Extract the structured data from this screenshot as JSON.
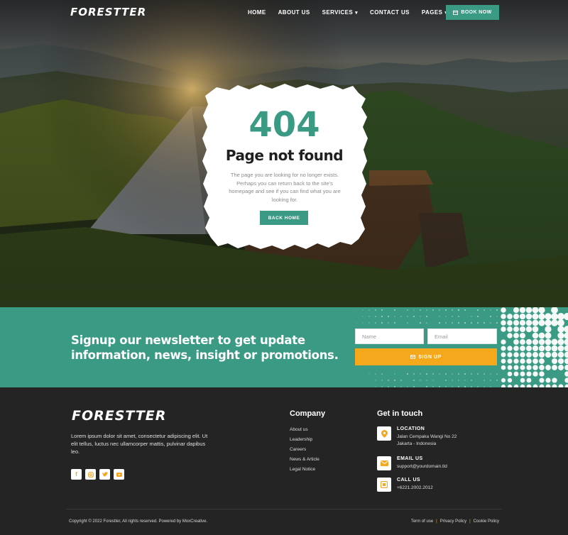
{
  "brand": {
    "logo": "FORESTTER",
    "accent": "#3a9a84",
    "highlight": "#f5a623"
  },
  "nav": {
    "items": [
      {
        "label": "HOME",
        "dropdown": false
      },
      {
        "label": "ABOUT US",
        "dropdown": false
      },
      {
        "label": "SERVICES",
        "dropdown": true
      },
      {
        "label": "CONTACT US",
        "dropdown": false
      },
      {
        "label": "PAGES",
        "dropdown": true
      }
    ],
    "book_label": "BOOK NOW"
  },
  "error": {
    "code": "404",
    "title": "Page not found",
    "description": "The page you are looking for no longer exists. Perhaps you can return back to the site's homepage and see if you can find what you are looking for.",
    "button": "BACK HOME"
  },
  "newsletter": {
    "heading": "Signup our newsletter to get update information, news, insight or promotions.",
    "name_placeholder": "Name",
    "email_placeholder": "Email",
    "button": "SIGN UP"
  },
  "footer": {
    "logo": "FORESTTER",
    "about": "Lorem ipsum dolor sit amet, consectetur adipiscing elit. Ut elit tellus, luctus nec ullamcorper mattis, pulvinar dapibus leo.",
    "socials": [
      "facebook",
      "instagram",
      "twitter",
      "youtube"
    ],
    "company": {
      "title": "Company",
      "links": [
        "About us",
        "Leadership",
        "Careers",
        "News & Article",
        "Legal Notice"
      ]
    },
    "contact": {
      "title": "Get in touch",
      "location_label": "LOCATION",
      "location_line1": "Jalan Cempaka Wangi No 22",
      "location_line2": "Jakarta - Indonesia",
      "email_label": "EMAIL US",
      "email": "support@yourdomain.tld",
      "call_label": "CALL US",
      "phone": "+6221.2002.2012"
    },
    "copyright": "Copyright © 2022 Forestter, All rights reserved. Powered by MoxCreative.",
    "legal": [
      "Term of use",
      "Privacy Policy",
      "Cookie Policy"
    ]
  }
}
